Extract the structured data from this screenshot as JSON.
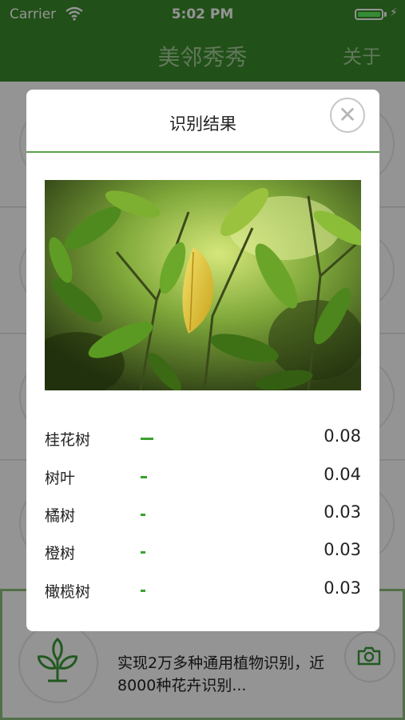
{
  "status_bar": {
    "carrier": "Carrier",
    "time": "5:02 PM",
    "battery_level": 1.0
  },
  "nav": {
    "title": "美邻秀秀",
    "about": "关于",
    "color": "#3a8a2a"
  },
  "bottom_card": {
    "description": "实现2万多种通用植物识别，近8000种花卉识别..."
  },
  "modal": {
    "title": "识别结果",
    "close_icon": "close-icon",
    "photo_subject": "leaves-photo",
    "results": [
      {
        "name": "桂花树",
        "score": "0.08",
        "value": 0.08
      },
      {
        "name": "树叶",
        "score": "0.04",
        "value": 0.04
      },
      {
        "name": "橘树",
        "score": "0.03",
        "value": 0.03
      },
      {
        "name": "橙树",
        "score": "0.03",
        "value": 0.03
      },
      {
        "name": "橄榄树",
        "score": "0.03",
        "value": 0.03
      }
    ],
    "accent": "#3aa12e"
  }
}
